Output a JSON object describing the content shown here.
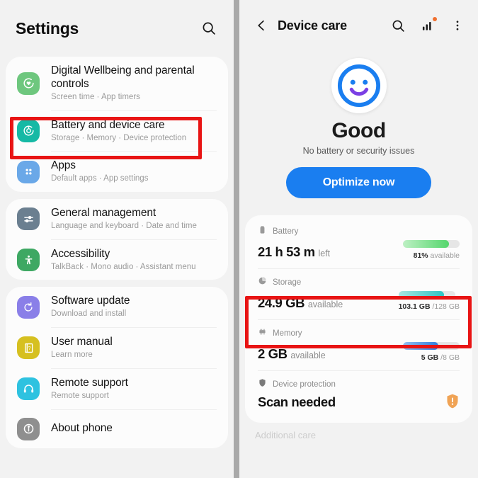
{
  "settings": {
    "title": "Settings",
    "search_icon": "search-icon",
    "groups": [
      {
        "items": [
          {
            "title": "Digital Wellbeing and parental controls",
            "subtitle": "Screen time  ·  App timers",
            "icon": "heart-circle-icon",
            "icon_color": "#6ec77e"
          },
          {
            "title": "Battery and device care",
            "subtitle": "Storage  ·  Memory  ·  Device protection",
            "icon": "battery-care-icon",
            "icon_color": "#16b9a5"
          },
          {
            "title": "Apps",
            "subtitle": "Default apps  ·  App settings",
            "icon": "apps-grid-icon",
            "icon_color": "#6aa8e8"
          }
        ]
      },
      {
        "items": [
          {
            "title": "General management",
            "subtitle": "Language and keyboard  ·  Date and time",
            "icon": "sliders-icon",
            "icon_color": "#6b7f90"
          },
          {
            "title": "Accessibility",
            "subtitle": "TalkBack  ·  Mono audio  ·  Assistant menu",
            "icon": "accessibility-person-icon",
            "icon_color": "#3ea863"
          }
        ]
      },
      {
        "items": [
          {
            "title": "Software update",
            "subtitle": "Download and install",
            "icon": "software-update-icon",
            "icon_color": "#8a7fe8"
          },
          {
            "title": "User manual",
            "subtitle": "Learn more",
            "icon": "user-manual-icon",
            "icon_color": "#d6c020"
          },
          {
            "title": "Remote support",
            "subtitle": "Remote support",
            "icon": "headset-icon",
            "icon_color": "#2ec2e0"
          },
          {
            "title": "About phone",
            "subtitle": "",
            "icon": "info-icon",
            "icon_color": "#8f8f8f"
          }
        ]
      }
    ]
  },
  "device_care": {
    "header": {
      "back_icon": "chevron-left-icon",
      "title": "Device care",
      "search_icon": "search-icon",
      "stats_icon": "bar-chart-icon",
      "stats_badge_color": "#f07030",
      "overflow_icon": "more-vertical-icon"
    },
    "hero": {
      "face_icon": "smiley-face-icon",
      "face_ring_color": "#1a7ef0",
      "smile_color": "#7b3fe4",
      "status": "Good",
      "subtitle": "No battery or security issues",
      "button_label": "Optimize now",
      "button_color": "#1a7ef0"
    },
    "rows": [
      {
        "icon": "battery-icon",
        "label": "Battery",
        "value": "21 h 53 m",
        "unit": "left",
        "meter_percent": 81,
        "meter_text_bold": "81%",
        "meter_text_rest": " available",
        "bar_from": "#bdf0c3",
        "bar_to": "#54d66c"
      },
      {
        "icon": "storage-pie-icon",
        "label": "Storage",
        "value": "24.9 GB",
        "unit": "available",
        "meter_percent": 80,
        "meter_text_bold": "103.1 GB",
        "meter_text_rest": " /128 GB",
        "bar_from": "#a8e5e2",
        "bar_to": "#2ec4c4"
      },
      {
        "icon": "memory-chip-icon",
        "label": "Memory",
        "value": "2 GB",
        "unit": "available",
        "meter_percent": 62,
        "meter_text_bold": "5 GB",
        "meter_text_rest": " /8 GB",
        "bar_from": "#93bff0",
        "bar_to": "#2f7fe0"
      }
    ],
    "protection": {
      "icon": "shield-icon",
      "label": "Device protection",
      "value": "Scan needed",
      "badge_icon": "shield-alert-icon",
      "badge_color": "#f0a355"
    },
    "additional_label": "Additional care"
  },
  "annotations": {
    "highlight_color": "#e81414",
    "boxes": [
      {
        "name": "battery-and-device-care-highlight"
      },
      {
        "name": "storage-row-highlight"
      }
    ]
  }
}
